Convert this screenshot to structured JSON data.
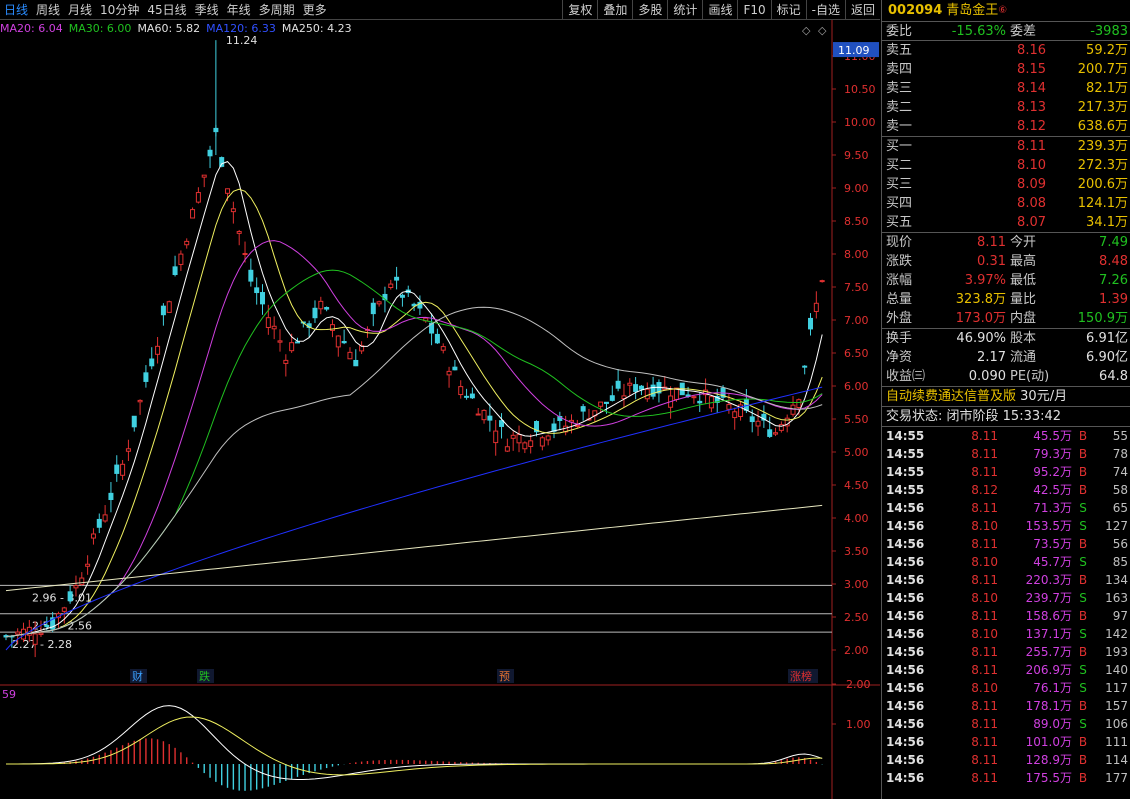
{
  "toolbar": {
    "left": [
      "日线",
      "周线",
      "月线",
      "10分钟",
      "45日线",
      "季线",
      "年线",
      "多周期",
      "更多"
    ],
    "right": [
      "复权",
      "叠加",
      "多股",
      "统计",
      "画线",
      "F10",
      "标记",
      "-自选",
      "返回"
    ]
  },
  "ma_legend": [
    {
      "text": "MA20: 6.04",
      "color": "#d040e0"
    },
    {
      "text": "MA30: 6.00",
      "color": "#20c020"
    },
    {
      "text": "MA60: 5.82",
      "color": "#e0e0e0"
    },
    {
      "text": "MA120: 6.33",
      "color": "#3050ff"
    },
    {
      "text": "MA250: 4.23",
      "color": "#e0e0e0"
    }
  ],
  "chart_data": {
    "type": "candlestick",
    "price_axis": [
      "11.00",
      "10.50",
      "10.00",
      "9.50",
      "9.00",
      "8.50",
      "8.00",
      "7.50",
      "7.00",
      "6.50",
      "6.00",
      "5.50",
      "5.00",
      "4.50",
      "4.00",
      "3.50",
      "3.00",
      "2.50",
      "2.00"
    ],
    "current_price_label": "11.09",
    "high_label": "11.24",
    "range_labels": [
      "2.96 - 3.01",
      "2.54 - 2.56",
      "2.27 - 2.28"
    ],
    "event_labels": [
      {
        "text": "财",
        "color": "#3aa0ff"
      },
      {
        "text": "跌",
        "color": "#20c020"
      },
      {
        "text": "预",
        "color": "#e07030"
      },
      {
        "text": "涨榜",
        "color": "#e03030"
      }
    ],
    "macd_axis": [
      "2.00",
      "1.00"
    ],
    "macd_label": "59",
    "ylim": [
      2.0,
      11.0
    ]
  },
  "stock": {
    "code": "002094",
    "name": "青岛金王",
    "mark": "⑥"
  },
  "weibi": {
    "label": "委比",
    "value": "-15.63%",
    "label2": "委差",
    "value2": "-3983"
  },
  "asks": [
    {
      "label": "卖五",
      "price": "8.16",
      "vol": "59.2万"
    },
    {
      "label": "卖四",
      "price": "8.15",
      "vol": "200.7万"
    },
    {
      "label": "卖三",
      "price": "8.14",
      "vol": "82.1万"
    },
    {
      "label": "卖二",
      "price": "8.13",
      "vol": "217.3万"
    },
    {
      "label": "卖一",
      "price": "8.12",
      "vol": "638.6万"
    }
  ],
  "bids": [
    {
      "label": "买一",
      "price": "8.11",
      "vol": "239.3万"
    },
    {
      "label": "买二",
      "price": "8.10",
      "vol": "272.3万"
    },
    {
      "label": "买三",
      "price": "8.09",
      "vol": "200.6万"
    },
    {
      "label": "买四",
      "price": "8.08",
      "vol": "124.1万"
    },
    {
      "label": "买五",
      "price": "8.07",
      "vol": "34.1万"
    }
  ],
  "quote": [
    {
      "l1": "现价",
      "v1": "8.11",
      "c1": "red",
      "l2": "今开",
      "v2": "7.49",
      "c2": "green"
    },
    {
      "l1": "涨跌",
      "v1": "0.31",
      "c1": "red",
      "l2": "最高",
      "v2": "8.48",
      "c2": "red"
    },
    {
      "l1": "涨幅",
      "v1": "3.97%",
      "c1": "red",
      "l2": "最低",
      "v2": "7.26",
      "c2": "green"
    },
    {
      "l1": "总量",
      "v1": "323.8万",
      "c1": "yellow",
      "l2": "量比",
      "v2": "1.39",
      "c2": "red"
    },
    {
      "l1": "外盘",
      "v1": "173.0万",
      "c1": "red",
      "l2": "内盘",
      "v2": "150.9万",
      "c2": "green"
    }
  ],
  "fundamentals": [
    {
      "l1": "换手",
      "v1": "46.90%",
      "l2": "股本",
      "v2": "6.91亿"
    },
    {
      "l1": "净资",
      "v1": "2.17",
      "l2": "流通",
      "v2": "6.90亿"
    },
    {
      "l1": "收益㈢",
      "v1": "0.090",
      "l2": "PE(动)",
      "v2": "64.8"
    }
  ],
  "promo": {
    "text": "自动续费通达信普及版",
    "price": "30元/月"
  },
  "status": {
    "label": "交易状态:",
    "value": "闭市阶段 15:33:42"
  },
  "ticks": [
    {
      "t": "14:55",
      "p": "8.11",
      "v": "45.5万",
      "bs": "B",
      "n": "55"
    },
    {
      "t": "14:55",
      "p": "8.11",
      "v": "79.3万",
      "bs": "B",
      "n": "78"
    },
    {
      "t": "14:55",
      "p": "8.11",
      "v": "95.2万",
      "bs": "B",
      "n": "74"
    },
    {
      "t": "14:55",
      "p": "8.12",
      "v": "42.5万",
      "bs": "B",
      "n": "58"
    },
    {
      "t": "14:56",
      "p": "8.11",
      "v": "71.3万",
      "bs": "S",
      "n": "65"
    },
    {
      "t": "14:56",
      "p": "8.10",
      "v": "153.5万",
      "bs": "S",
      "n": "127"
    },
    {
      "t": "14:56",
      "p": "8.11",
      "v": "73.5万",
      "bs": "B",
      "n": "56"
    },
    {
      "t": "14:56",
      "p": "8.10",
      "v": "45.7万",
      "bs": "S",
      "n": "85"
    },
    {
      "t": "14:56",
      "p": "8.11",
      "v": "220.3万",
      "bs": "B",
      "n": "134"
    },
    {
      "t": "14:56",
      "p": "8.10",
      "v": "239.7万",
      "bs": "S",
      "n": "163"
    },
    {
      "t": "14:56",
      "p": "8.11",
      "v": "158.6万",
      "bs": "B",
      "n": "97"
    },
    {
      "t": "14:56",
      "p": "8.10",
      "v": "137.1万",
      "bs": "S",
      "n": "142"
    },
    {
      "t": "14:56",
      "p": "8.11",
      "v": "255.7万",
      "bs": "B",
      "n": "193"
    },
    {
      "t": "14:56",
      "p": "8.11",
      "v": "206.9万",
      "bs": "S",
      "n": "140"
    },
    {
      "t": "14:56",
      "p": "8.10",
      "v": "76.1万",
      "bs": "S",
      "n": "117"
    },
    {
      "t": "14:56",
      "p": "8.11",
      "v": "178.1万",
      "bs": "B",
      "n": "157"
    },
    {
      "t": "14:56",
      "p": "8.11",
      "v": "89.0万",
      "bs": "S",
      "n": "106"
    },
    {
      "t": "14:56",
      "p": "8.11",
      "v": "101.0万",
      "bs": "B",
      "n": "111"
    },
    {
      "t": "14:56",
      "p": "8.11",
      "v": "128.9万",
      "bs": "B",
      "n": "114"
    },
    {
      "t": "14:56",
      "p": "8.11",
      "v": "175.5万",
      "bs": "B",
      "n": "177"
    }
  ]
}
